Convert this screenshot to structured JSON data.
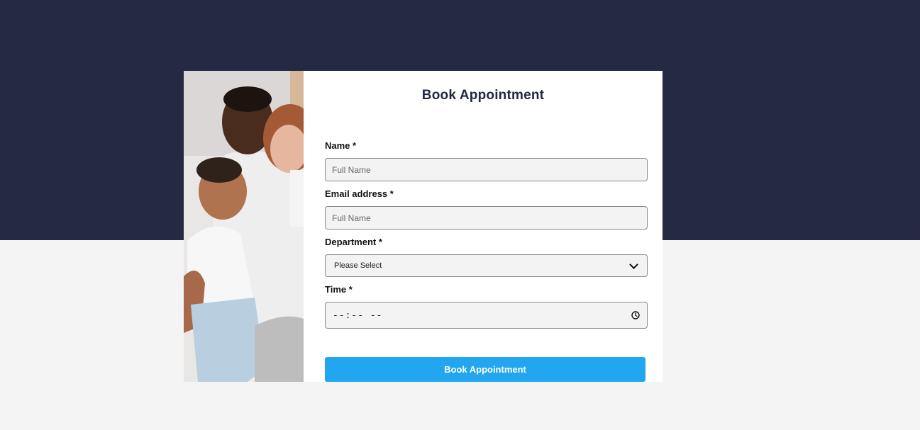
{
  "form": {
    "title": "Book Appointment",
    "name": {
      "label": "Name *",
      "placeholder": "Full Name",
      "value": ""
    },
    "email": {
      "label": "Email address *",
      "placeholder": "Full Name",
      "value": ""
    },
    "department": {
      "label": "Department *",
      "selected": "Please Select"
    },
    "time": {
      "label": "Time *",
      "display": "--:-- --"
    },
    "submit_label": "Book Appointment"
  },
  "icons": {
    "select_arrow": "chevron-down-icon",
    "time_picker": "clock-icon"
  },
  "colors": {
    "header_band": "#252944",
    "page_background": "#f4f4f4",
    "title_text": "#23283f",
    "button": "#21a6ef",
    "input_background": "#f3f3f3"
  }
}
